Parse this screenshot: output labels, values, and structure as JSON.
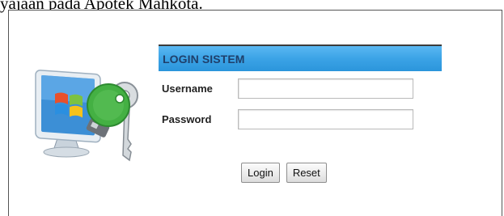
{
  "document": {
    "caption": "yajaan pada Apotek Mahkota."
  },
  "login_form": {
    "title": "LOGIN SISTEM",
    "username_label": "Username",
    "password_label": "Password",
    "username_value": "",
    "password_value": "",
    "login_button": "Login",
    "reset_button": "Reset"
  },
  "colors": {
    "header_blue": "#3ba3e6",
    "header_text": "#1f3f6a",
    "key_green": "#44b043"
  },
  "icons": {
    "illustration": "monitor-with-keys-icon"
  }
}
